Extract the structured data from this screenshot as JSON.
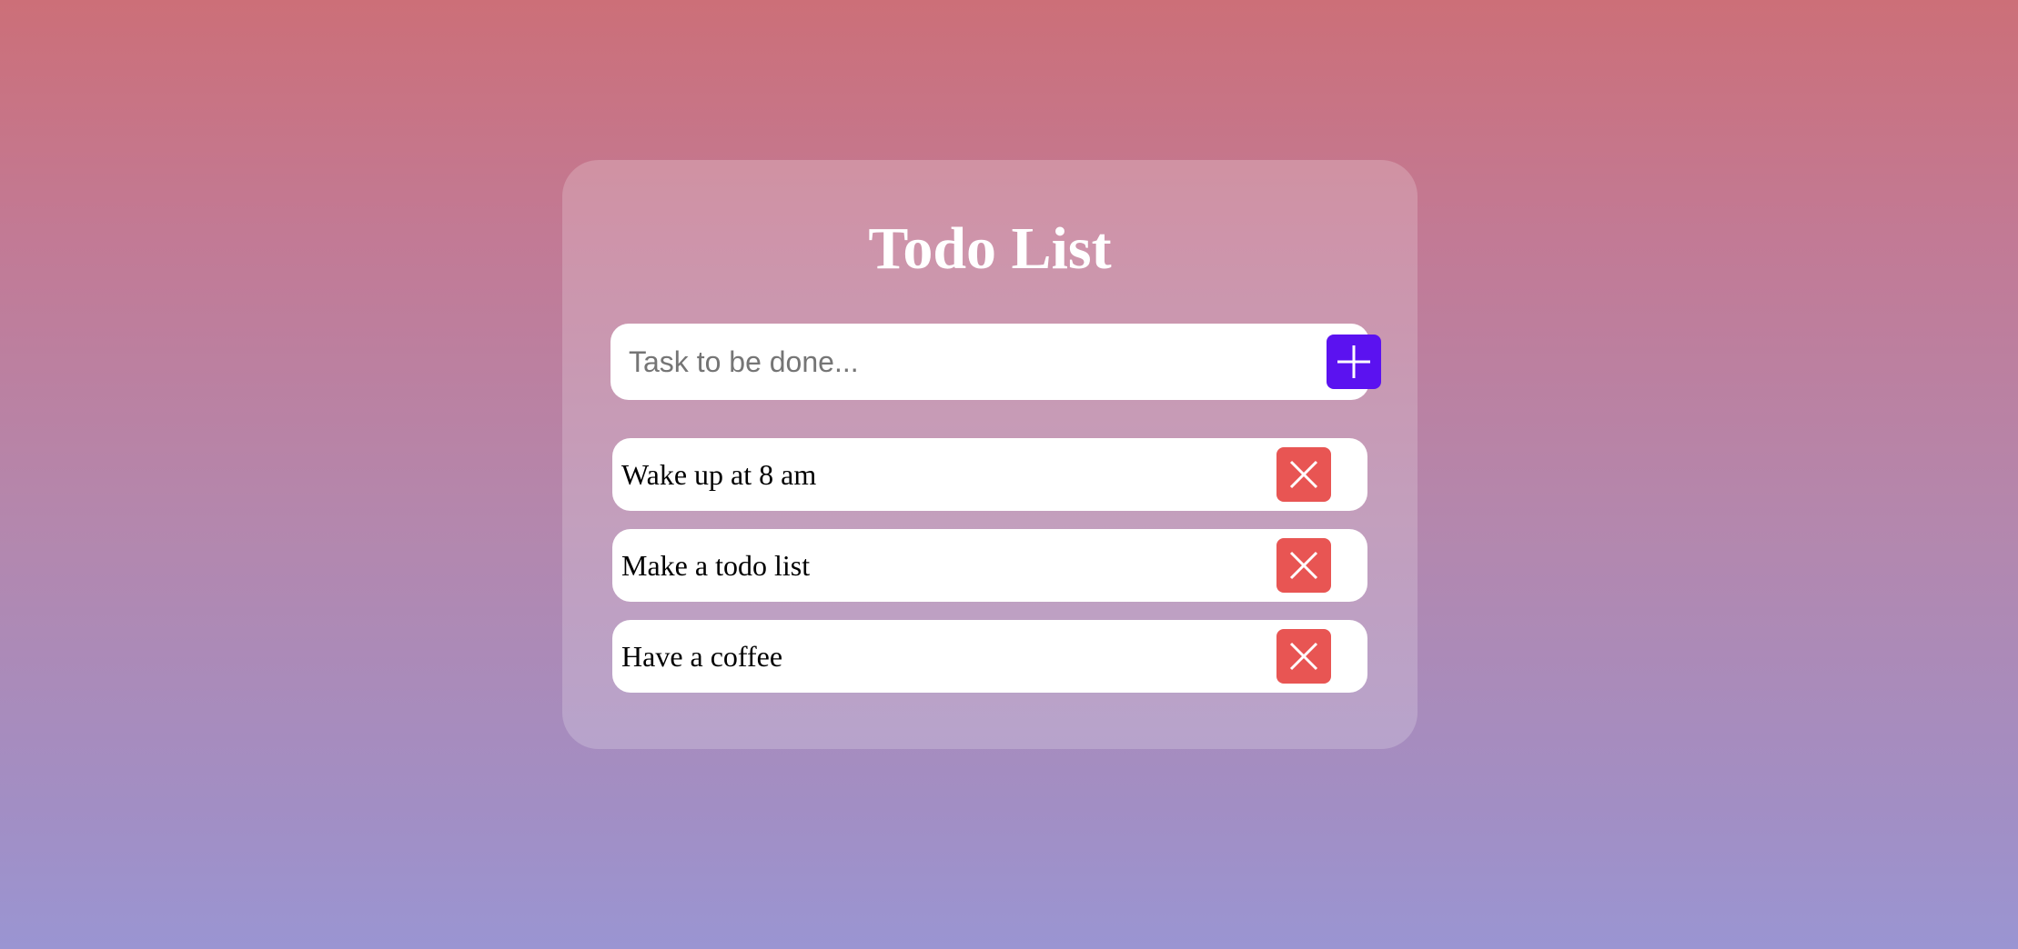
{
  "app": {
    "title": "Todo List"
  },
  "input": {
    "placeholder": "Task to be done...",
    "value": "",
    "add_icon": "plus-icon"
  },
  "tasks": [
    {
      "text": "Wake up at 8 am",
      "delete_icon": "close-icon"
    },
    {
      "text": "Make a todo list",
      "delete_icon": "close-icon"
    },
    {
      "text": "Have a coffee",
      "delete_icon": "close-icon"
    }
  ],
  "colors": {
    "add_button": "#5b12f0",
    "delete_button": "#e85553",
    "title_text": "#ffffff"
  }
}
